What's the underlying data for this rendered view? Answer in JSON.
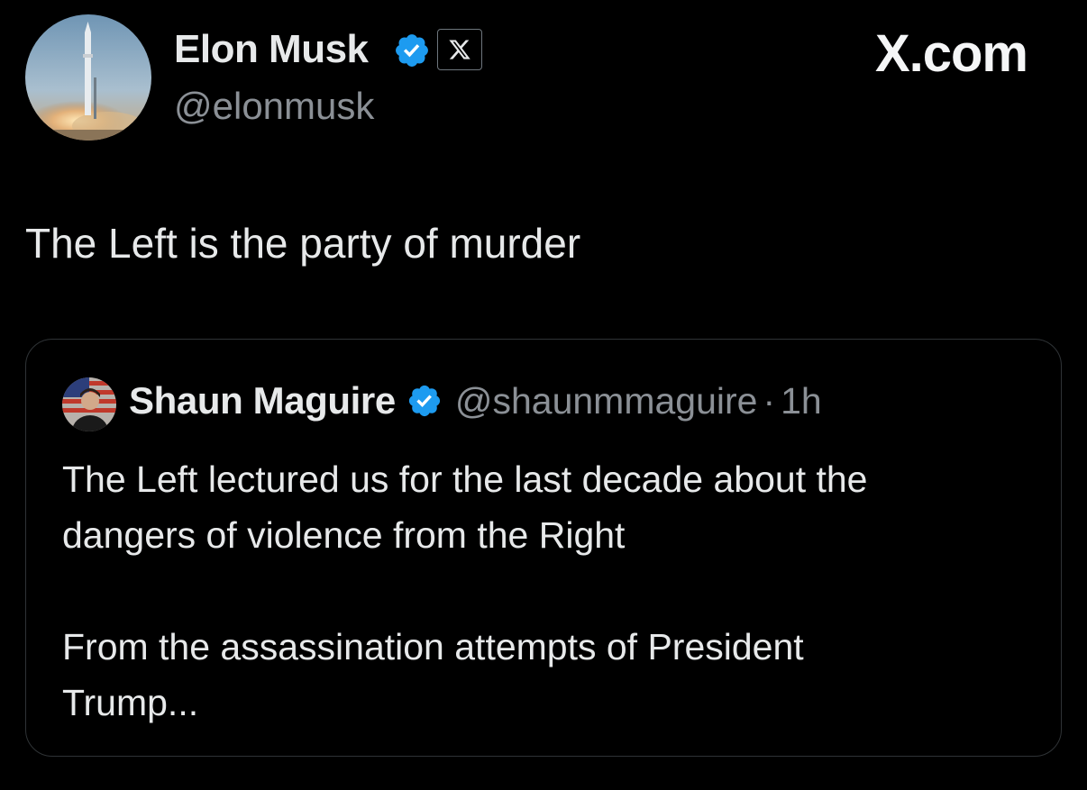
{
  "tweet": {
    "author": {
      "name": "Elon Musk",
      "handle": "@elonmusk",
      "verified": true,
      "affiliation_badge": "X"
    },
    "text": "The Left is the party of murder"
  },
  "brand": "X.com",
  "quoted_tweet": {
    "author": {
      "name": "Shaun Maguire",
      "handle": "@shaunmmaguire",
      "verified": true
    },
    "separator": "·",
    "time": "1h",
    "lines": [
      "The Left lectured us for the last decade about the",
      "dangers of violence from the Right"
    ],
    "lines2": [
      "From the assassination attempts of President",
      "Trump..."
    ]
  },
  "icons": {
    "verified": "verified-badge-icon",
    "affiliation": "x-logo-icon"
  },
  "colors": {
    "background": "#000000",
    "verified_blue": "#1d9bf0",
    "text_primary": "#e7e9ea",
    "text_secondary": "#8b9096",
    "border": "#2f3336"
  }
}
